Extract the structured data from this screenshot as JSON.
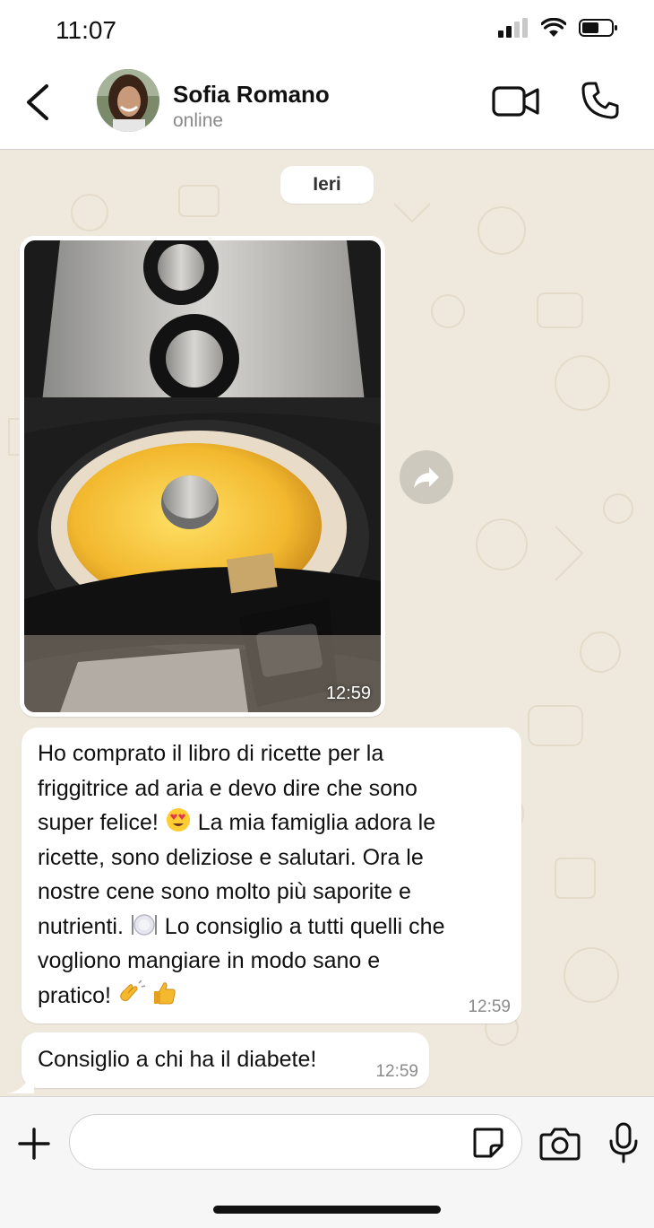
{
  "status_bar": {
    "time": "11:07"
  },
  "header": {
    "contact_name": "Sofia Romano",
    "contact_status": "online"
  },
  "chat": {
    "date_separator": "Ieri",
    "image_message": {
      "time": "12:59"
    },
    "messages": [
      {
        "lines": [
          "Ho comprato il libro di ricette per la",
          "friggitrice ad aria e devo dire che sono",
          "super felice! ",
          " La mia famiglia adora le",
          "ricette, sono deliziose e salutari. Ora le",
          "nostre cene sono molto più saporite e",
          "nutrienti. ",
          " Lo consiglio a tutti quelli che",
          "vogliono mangiare in modo sano e",
          "pratico! "
        ],
        "emojis": [
          "heart-eyes-emoji",
          "plate-emoji",
          "clapping-hands-emoji",
          "thumbs-up-emoji"
        ],
        "time": "12:59"
      },
      {
        "text": "Consiglio a chi ha il diabete!",
        "time": "12:59"
      }
    ]
  },
  "input": {
    "placeholder": ""
  },
  "icons": [
    "back-arrow-icon",
    "video-call-icon",
    "phone-icon",
    "forward-icon",
    "plus-icon",
    "sticker-icon",
    "camera-icon",
    "microphone-icon",
    "signal-icon",
    "wifi-icon",
    "battery-icon"
  ],
  "colors": {
    "chat_bg": "#efe9dd",
    "bubble": "#ffffff",
    "header_bg": "#ffffff",
    "input_bar": "#f6f6f6"
  }
}
